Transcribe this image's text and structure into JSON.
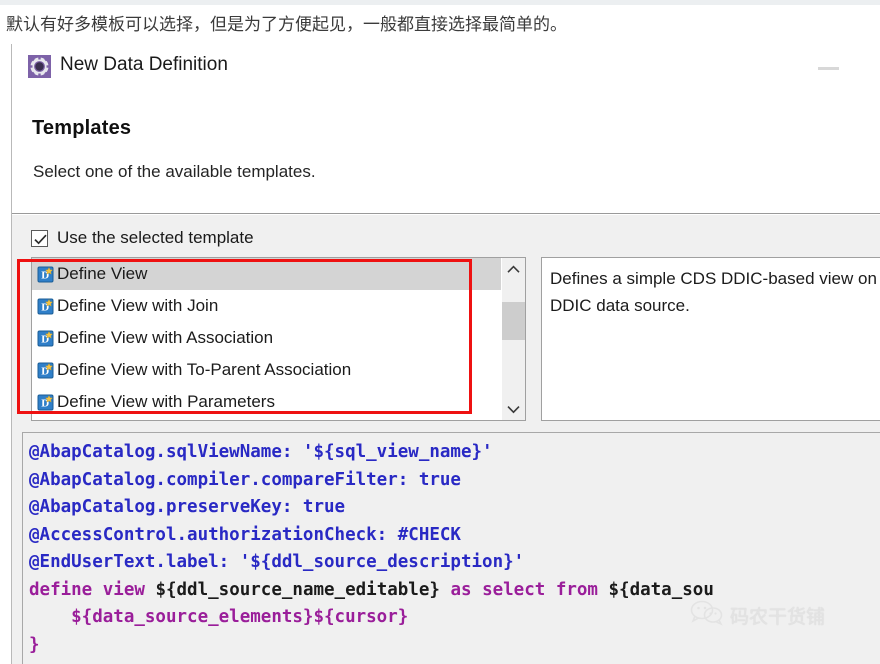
{
  "caption": "默认有好多模板可以选择，但是为了方便起见，一般都直接选择最简单的。",
  "window": {
    "title": "New Data Definition",
    "icon": "gear-icon",
    "minimize_label": "—"
  },
  "header": {
    "title": "Templates",
    "subtitle": "Select one of the available templates."
  },
  "checkbox": {
    "label": "Use the selected template",
    "checked": true
  },
  "template_list": {
    "items": [
      {
        "label": "Define View",
        "selected": true
      },
      {
        "label": "Define View with Join",
        "selected": false
      },
      {
        "label": "Define View with Association",
        "selected": false
      },
      {
        "label": "Define View with To-Parent Association",
        "selected": false
      },
      {
        "label": "Define View with Parameters",
        "selected": false
      }
    ],
    "scroll_up_icon": "chevron-up-icon",
    "scroll_down_icon": "chevron-down-icon"
  },
  "description": {
    "text": "Defines a simple CDS DDIC-based view on a DDIC data source."
  },
  "code_preview": {
    "lines": [
      {
        "text": "@AbapCatalog.sqlViewName: '${sql_view_name}'",
        "style": "annotation"
      },
      {
        "text": "@AbapCatalog.compiler.compareFilter: true",
        "style": "annotation"
      },
      {
        "text": "@AbapCatalog.preserveKey: true",
        "style": "annotation"
      },
      {
        "text": "@AccessControl.authorizationCheck: #CHECK",
        "style": "annotation"
      },
      {
        "text": "@EndUserText.label: '${ddl_source_description}'",
        "style": "annotation"
      }
    ],
    "define_line": {
      "kw1": "define view ",
      "name": "${ddl_source_name_editable}",
      "kw2": " as select from ",
      "source": "${data_sou"
    },
    "body_line": "    ${data_source_elements}${cursor}",
    "close_line": "}"
  },
  "watermark": {
    "text": "码农干货铺",
    "icon": "wechat-icon"
  },
  "colors": {
    "highlight_red": "#ee1111",
    "annotation_blue": "#2929c4",
    "keyword_purple": "#9a1e9a",
    "selection_gray": "#d4d4d4",
    "dialog_icon_purple": "#7d62a8"
  }
}
